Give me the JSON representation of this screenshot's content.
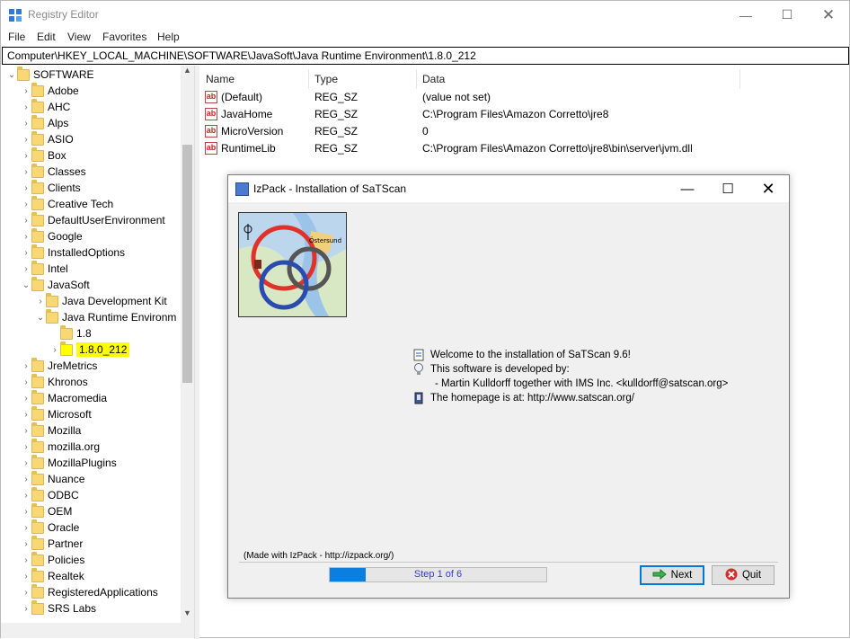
{
  "registry": {
    "title": "Registry Editor",
    "menu": [
      "File",
      "Edit",
      "View",
      "Favorites",
      "Help"
    ],
    "address": "Computer\\HKEY_LOCAL_MACHINE\\SOFTWARE\\JavaSoft\\Java Runtime Environment\\1.8.0_212",
    "tree": {
      "root": "SOFTWARE",
      "items": [
        "Adobe",
        "AHC",
        "Alps",
        "ASIO",
        "Box",
        "Classes",
        "Clients",
        "Creative Tech",
        "DefaultUserEnvironment",
        "Google",
        "InstalledOptions",
        "Intel",
        "JavaSoft"
      ],
      "javasoft_children": [
        "Java Development Kit",
        "Java Runtime Environm"
      ],
      "jre_children": [
        "1.8",
        "1.8.0_212"
      ],
      "after": [
        "JreMetrics",
        "Khronos",
        "Macromedia",
        "Microsoft",
        "Mozilla",
        "mozilla.org",
        "MozillaPlugins",
        "Nuance",
        "ODBC",
        "OEM",
        "Oracle",
        "Partner",
        "Policies",
        "Realtek",
        "RegisteredApplications",
        "SRS Labs"
      ],
      "highlight_color": "#ffff00"
    },
    "columns": [
      "Name",
      "Type",
      "Data"
    ],
    "values": [
      {
        "name": "(Default)",
        "type": "REG_SZ",
        "data": "(value not set)"
      },
      {
        "name": "JavaHome",
        "type": "REG_SZ",
        "data": "C:\\Program Files\\Amazon Corretto\\jre8"
      },
      {
        "name": "MicroVersion",
        "type": "REG_SZ",
        "data": "0"
      },
      {
        "name": "RuntimeLib",
        "type": "REG_SZ",
        "data": "C:\\Program Files\\Amazon Corretto\\jre8\\bin\\server\\jvm.dll"
      }
    ]
  },
  "installer": {
    "title": "IzPack - Installation of  SaTScan",
    "info": {
      "welcome": "Welcome to the installation of SaTScan 9.6!",
      "developed_by": "This software is developed by:",
      "author": "- Martin Kulldorff together with IMS Inc. <kulldorff@satscan.org>",
      "homepage": "The homepage is at: http://www.satscan.org/"
    },
    "made_with": "(Made with IzPack - http://izpack.org/)",
    "progress": {
      "text": "Step 1 of 6",
      "fraction": 0.1667,
      "color": "#0a7fe0"
    },
    "next_label": "Next",
    "quit_label": "Quit",
    "map_label": "Östersund"
  }
}
